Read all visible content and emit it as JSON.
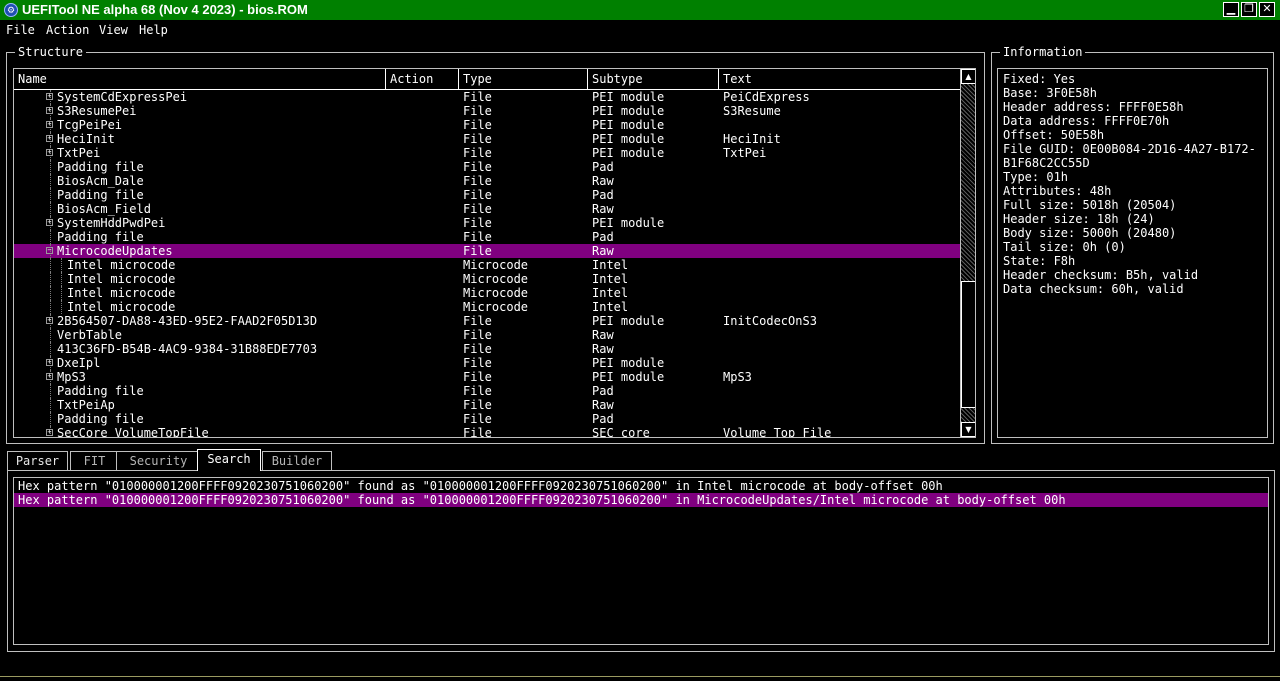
{
  "window": {
    "title": "UEFITool NE alpha 68 (Nov  4 2023) - bios.ROM",
    "icon": "app-icon",
    "controls": [
      "minimize-icon",
      "restore-icon",
      "close-icon"
    ],
    "accent_color": "#008000",
    "selection_color": "#800080"
  },
  "menu": {
    "items": [
      "File",
      "Action",
      "View",
      "Help"
    ]
  },
  "structure": {
    "title": "Structure",
    "columns": [
      "Name",
      "Action",
      "Type",
      "Subtype",
      "Text"
    ],
    "rows": [
      {
        "depth": 1,
        "expand": "+",
        "name": "SystemCdExpressPei",
        "action": "",
        "type": "File",
        "subtype": "PEI module",
        "text": "PeiCdExpress"
      },
      {
        "depth": 1,
        "expand": "+",
        "name": "S3ResumePei",
        "action": "",
        "type": "File",
        "subtype": "PEI module",
        "text": "S3Resume"
      },
      {
        "depth": 1,
        "expand": "+",
        "name": "TcgPeiPei",
        "action": "",
        "type": "File",
        "subtype": "PEI module",
        "text": ""
      },
      {
        "depth": 1,
        "expand": "+",
        "name": "HeciInit",
        "action": "",
        "type": "File",
        "subtype": "PEI module",
        "text": "HeciInit"
      },
      {
        "depth": 1,
        "expand": "+",
        "name": "TxtPei",
        "action": "",
        "type": "File",
        "subtype": "PEI module",
        "text": "TxtPei"
      },
      {
        "depth": 1,
        "expand": "",
        "name": "Padding file",
        "action": "",
        "type": "File",
        "subtype": "Pad",
        "text": ""
      },
      {
        "depth": 1,
        "expand": "",
        "name": "BiosAcm_Dale",
        "action": "",
        "type": "File",
        "subtype": "Raw",
        "text": ""
      },
      {
        "depth": 1,
        "expand": "",
        "name": "Padding file",
        "action": "",
        "type": "File",
        "subtype": "Pad",
        "text": ""
      },
      {
        "depth": 1,
        "expand": "",
        "name": "BiosAcm_Field",
        "action": "",
        "type": "File",
        "subtype": "Raw",
        "text": ""
      },
      {
        "depth": 1,
        "expand": "+",
        "name": "SystemHddPwdPei",
        "action": "",
        "type": "File",
        "subtype": "PEI module",
        "text": ""
      },
      {
        "depth": 1,
        "expand": "",
        "name": "Padding file",
        "action": "",
        "type": "File",
        "subtype": "Pad",
        "text": ""
      },
      {
        "depth": 1,
        "expand": "-",
        "name": "MicrocodeUpdates",
        "action": "",
        "type": "File",
        "subtype": "Raw",
        "text": "",
        "selected": true
      },
      {
        "depth": 2,
        "expand": "",
        "name": "Intel microcode",
        "action": "",
        "type": "Microcode",
        "subtype": "Intel",
        "text": ""
      },
      {
        "depth": 2,
        "expand": "",
        "name": "Intel microcode",
        "action": "",
        "type": "Microcode",
        "subtype": "Intel",
        "text": ""
      },
      {
        "depth": 2,
        "expand": "",
        "name": "Intel microcode",
        "action": "",
        "type": "Microcode",
        "subtype": "Intel",
        "text": ""
      },
      {
        "depth": 2,
        "expand": "",
        "name": "Intel microcode",
        "action": "",
        "type": "Microcode",
        "subtype": "Intel",
        "text": ""
      },
      {
        "depth": 1,
        "expand": "+",
        "name": "2B564507-DA88-43ED-95E2-FAAD2F05D13D",
        "action": "",
        "type": "File",
        "subtype": "PEI module",
        "text": "InitCodecOnS3"
      },
      {
        "depth": 1,
        "expand": "",
        "name": "VerbTable",
        "action": "",
        "type": "File",
        "subtype": "Raw",
        "text": ""
      },
      {
        "depth": 1,
        "expand": "",
        "name": "413C36FD-B54B-4AC9-9384-31B88EDE7703",
        "action": "",
        "type": "File",
        "subtype": "Raw",
        "text": ""
      },
      {
        "depth": 1,
        "expand": "+",
        "name": "DxeIpl",
        "action": "",
        "type": "File",
        "subtype": "PEI module",
        "text": ""
      },
      {
        "depth": 1,
        "expand": "+",
        "name": "MpS3",
        "action": "",
        "type": "File",
        "subtype": "PEI module",
        "text": "MpS3"
      },
      {
        "depth": 1,
        "expand": "",
        "name": "Padding file",
        "action": "",
        "type": "File",
        "subtype": "Pad",
        "text": ""
      },
      {
        "depth": 1,
        "expand": "",
        "name": "TxtPeiAp",
        "action": "",
        "type": "File",
        "subtype": "Raw",
        "text": ""
      },
      {
        "depth": 1,
        "expand": "",
        "name": "Padding file",
        "action": "",
        "type": "File",
        "subtype": "Pad",
        "text": ""
      },
      {
        "depth": 1,
        "expand": "+",
        "name": "SecCore_VolumeTopFile",
        "action": "",
        "type": "File",
        "subtype": "SEC core",
        "text": "Volume Top File"
      }
    ]
  },
  "information": {
    "title": "Information",
    "lines": [
      "Fixed: Yes",
      "Base: 3F0E58h",
      "Header address: FFFF0E58h",
      "Data address: FFFF0E70h",
      "Offset: 50E58h",
      "File GUID: 0E00B084-2D16-4A27-B172-",
      "B1F68C2CC55D",
      "Type: 01h",
      "Attributes: 48h",
      "Full size: 5018h (20504)",
      "Header size: 18h (24)",
      "Body size: 5000h (20480)",
      "Tail size: 0h (0)",
      "State: F8h",
      "Header checksum: B5h, valid",
      "Data checksum: 60h, valid"
    ]
  },
  "tabs": {
    "items": [
      "Parser",
      "FIT",
      "Security",
      "Search",
      "Builder"
    ],
    "active": "Search"
  },
  "search_results": [
    {
      "text": "Hex pattern \"010000001200FFFF0920230751060200\" found as \"010000001200FFFF0920230751060200\" in Intel microcode at body-offset 00h",
      "selected": false
    },
    {
      "text": "Hex pattern \"010000001200FFFF0920230751060200\" found as \"010000001200FFFF0920230751060200\" in MicrocodeUpdates/Intel microcode at body-offset 00h",
      "selected": true
    }
  ]
}
